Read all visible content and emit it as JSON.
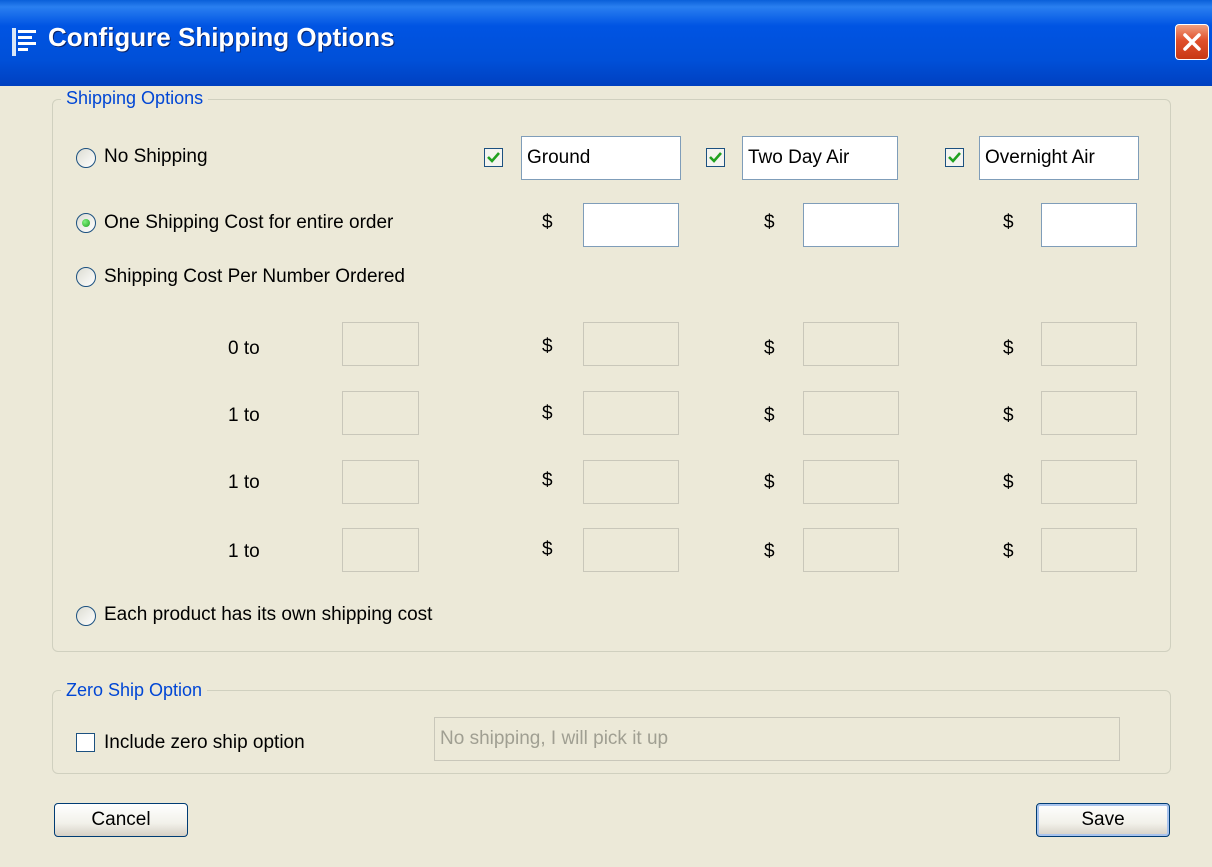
{
  "window": {
    "title": "Configure Shipping Options"
  },
  "shipping_options": {
    "legend": "Shipping Options",
    "no_shipping_label": "No Shipping",
    "one_cost_label": "One Shipping Cost for entire order",
    "per_number_label": "Shipping Cost Per Number Ordered",
    "each_product_label": "Each product has its own shipping cost",
    "selected_option": "One Shipping Cost for entire order",
    "methods": [
      {
        "name": "Ground",
        "checked": true
      },
      {
        "name": "Two Day Air",
        "checked": true
      },
      {
        "name": "Overnight Air",
        "checked": true
      }
    ],
    "currency_symbol": "$",
    "one_cost_values": [
      "",
      "",
      ""
    ],
    "tiers": [
      {
        "label": "0 to",
        "qty": "",
        "costs": [
          "",
          "",
          ""
        ]
      },
      {
        "label": "1 to",
        "qty": "",
        "costs": [
          "",
          "",
          ""
        ]
      },
      {
        "label": "1 to",
        "qty": "",
        "costs": [
          "",
          "",
          ""
        ]
      },
      {
        "label": "1 to",
        "qty": "",
        "costs": [
          "",
          "",
          ""
        ]
      }
    ]
  },
  "zero_ship": {
    "legend": "Zero Ship Option",
    "include_label": "Include zero ship option",
    "include_checked": false,
    "text_value": "No shipping, I will pick it up"
  },
  "buttons": {
    "cancel": "Cancel",
    "save": "Save"
  },
  "colors": {
    "title_bar": "#0054e3",
    "legend_text": "#0046d5",
    "close_button": "#e0502c",
    "check_mark": "#21a121"
  }
}
